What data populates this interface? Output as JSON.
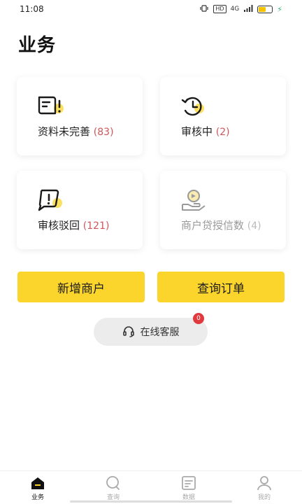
{
  "status_bar": {
    "time": "11:08",
    "network": "4G",
    "hd": "HD"
  },
  "page": {
    "title": "业务"
  },
  "cards": [
    {
      "label": "资料未完善",
      "count": "(83)",
      "icon": "document-alert-icon"
    },
    {
      "label": "审核中",
      "count": "(2)",
      "icon": "clock-refresh-icon"
    },
    {
      "label": "审核驳回",
      "count": "(121)",
      "icon": "chat-alert-icon"
    },
    {
      "label": "商户贷授信数",
      "count": "(4)",
      "icon": "coin-hand-icon"
    }
  ],
  "actions": {
    "add_merchant": "新增商户",
    "query_order": "查询订单"
  },
  "service": {
    "label": "在线客服",
    "badge": "0"
  },
  "tabs": [
    {
      "label": "业务",
      "icon": "home-icon",
      "active": true
    },
    {
      "label": "查询",
      "icon": "search-icon",
      "active": false
    },
    {
      "label": "数据",
      "icon": "data-icon",
      "active": false
    },
    {
      "label": "我的",
      "icon": "profile-icon",
      "active": false
    }
  ],
  "colors": {
    "accent": "#fbd52b",
    "count_red": "#d0555a",
    "badge_red": "#e0393e"
  }
}
